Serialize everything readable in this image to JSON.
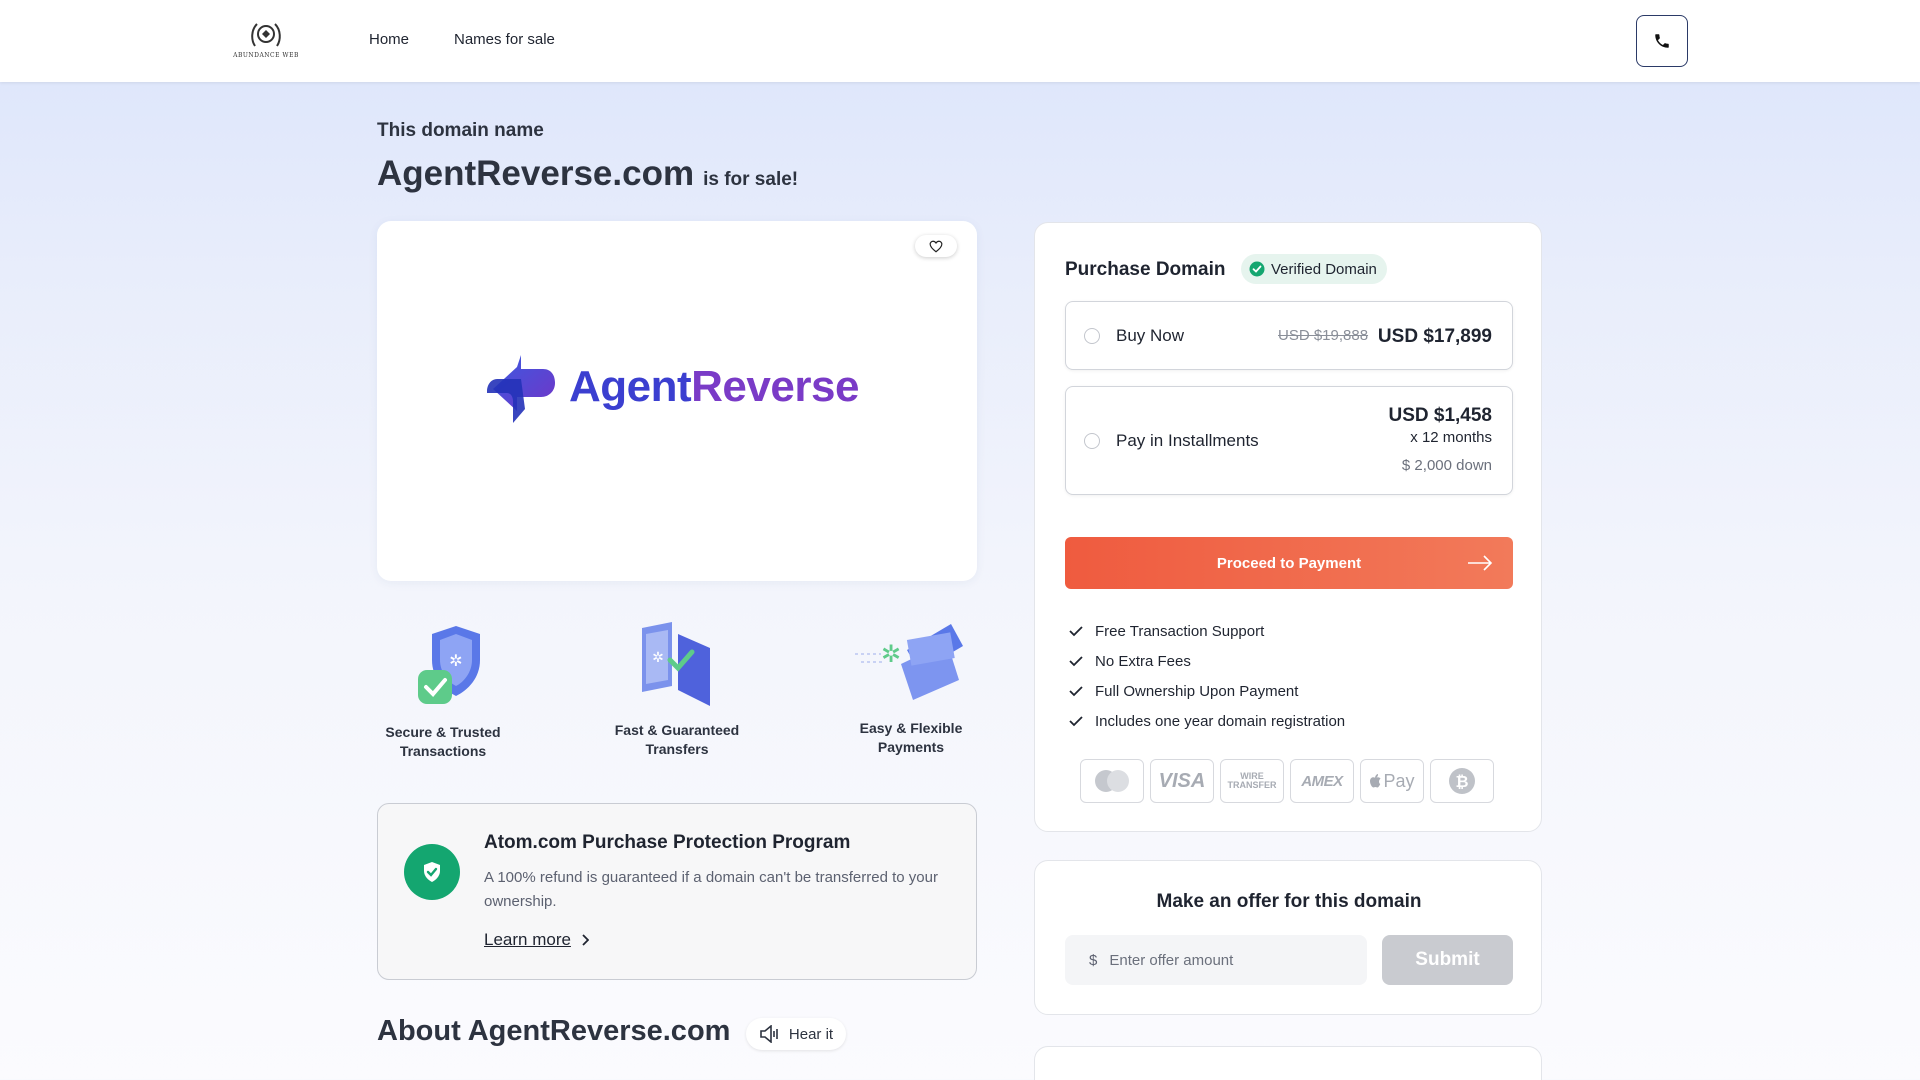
{
  "header": {
    "logo_text": "ABUNDANCE WEB",
    "nav": [
      {
        "label": "Home"
      },
      {
        "label": "Names for sale"
      }
    ]
  },
  "hero": {
    "kicker": "This domain name",
    "domain": "AgentReverse.com",
    "suffix": "is for sale!"
  },
  "logo_card": {
    "brand_part1": "Agent",
    "brand_part2": "Reverse",
    "colors": {
      "agent": "#3b3fd0",
      "reverse": "#7a3bc7"
    }
  },
  "features": [
    {
      "label_line1": "Secure & Trusted",
      "label_line2": "Transactions",
      "icon": "shield-check-icon"
    },
    {
      "label_line1": "Fast & Guaranteed",
      "label_line2": "Transfers",
      "icon": "transfer-icon"
    },
    {
      "label_line1": "Easy & Flexible",
      "label_line2": "Payments",
      "icon": "card-icon"
    }
  ],
  "protection": {
    "title": "Atom.com Purchase Protection Program",
    "description": "A 100% refund is guaranteed if a domain can't be transferred to your ownership.",
    "link": "Learn more"
  },
  "about": {
    "title": "About AgentReverse.com",
    "hear": "Hear it"
  },
  "purchase": {
    "title": "Purchase Domain",
    "verified": "Verified Domain",
    "buy_now": {
      "label": "Buy Now",
      "old_price": "USD $19,888",
      "price": "USD $17,899"
    },
    "installments": {
      "label": "Pay in Installments",
      "price": "USD $1,458",
      "term": "x 12 months",
      "down": "$ 2,000 down"
    },
    "proceed": "Proceed to Payment",
    "benefits": [
      "Free Transaction Support",
      "No Extra Fees",
      "Full Ownership Upon Payment",
      "Includes one year domain registration"
    ],
    "payment_methods": [
      {
        "name": "mastercard-icon",
        "label": ""
      },
      {
        "name": "visa-icon",
        "label": "VISA"
      },
      {
        "name": "wire-transfer-icon",
        "label": "WIRE TRANSFER"
      },
      {
        "name": "amex-icon",
        "label": "AMEX"
      },
      {
        "name": "apple-pay-icon",
        "label": "Pay"
      },
      {
        "name": "bitcoin-icon",
        "label": "₿"
      }
    ],
    "accent": "#ef5b3f"
  },
  "offer": {
    "title": "Make an offer for this domain",
    "currency": "$",
    "placeholder": "Enter offer amount",
    "submit": "Submit"
  }
}
